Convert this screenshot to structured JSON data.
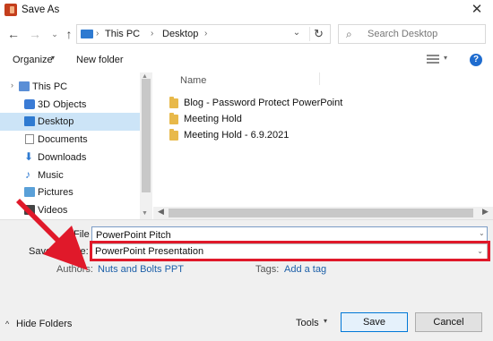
{
  "window": {
    "title": "Save As",
    "close_glyph": "✕"
  },
  "address": {
    "nav_back": "←",
    "nav_forward": "→",
    "nav_recent": "⌄",
    "nav_up": "↑",
    "sep": "›",
    "crumbs": [
      "This PC",
      "Desktop"
    ],
    "dropdown_glyph": "⌄",
    "refresh_glyph": "↻"
  },
  "search": {
    "placeholder": "Search Desktop",
    "icon": "search-icon",
    "glyph": "⌕"
  },
  "toolbar": {
    "organize_label": "Organize",
    "new_folder_label": "New folder",
    "caret": "▾",
    "help_glyph": "?"
  },
  "nav_pane": {
    "items": [
      {
        "label": "This PC",
        "icon": "computer-icon",
        "color": "#5a8ed6"
      },
      {
        "label": "3D Objects",
        "icon": "cube-icon",
        "color": "#3a7bd5"
      },
      {
        "label": "Desktop",
        "icon": "desktop-icon",
        "color": "#2e7ad1",
        "selected": true
      },
      {
        "label": "Documents",
        "icon": "document-icon",
        "color": "#8a8a8a"
      },
      {
        "label": "Downloads",
        "icon": "download-icon",
        "color": "#2e7ad1"
      },
      {
        "label": "Music",
        "icon": "music-icon",
        "color": "#2e7ad1"
      },
      {
        "label": "Pictures",
        "icon": "picture-icon",
        "color": "#5aa0d8"
      },
      {
        "label": "Videos",
        "icon": "video-icon",
        "color": "#444444"
      }
    ],
    "expand_glyph": "›",
    "scroll_up": "▲",
    "scroll_down": "▼"
  },
  "file_list": {
    "column_name": "Name",
    "items": [
      {
        "name": "Blog - Password Protect PowerPoint",
        "icon": "folder-icon"
      },
      {
        "name": "Meeting Hold",
        "icon": "folder-icon"
      },
      {
        "name": "Meeting Hold - 6.9.2021",
        "icon": "folder-icon"
      }
    ],
    "scroll_left": "◀",
    "scroll_right": "▶"
  },
  "form": {
    "filename_label": "File name:",
    "filename_value": "PowerPoint Pitch",
    "savetype_label": "Save as type:",
    "savetype_value": "PowerPoint Presentation",
    "authors_label": "Authors:",
    "authors_value": "Nuts and Bolts PPT",
    "tags_label": "Tags:",
    "tags_value": "Add a tag",
    "dropdown_caret": "⌄"
  },
  "footer": {
    "hide_folders_label": "Hide Folders",
    "hide_caret": "^",
    "tools_label": "Tools",
    "tools_caret": "▾",
    "save_label": "Save",
    "cancel_label": "Cancel"
  },
  "colors": {
    "highlight": "#e0192a",
    "annotation_arrow": "#e0192a",
    "link": "#1c5fa8",
    "selection": "#cce4f7"
  }
}
